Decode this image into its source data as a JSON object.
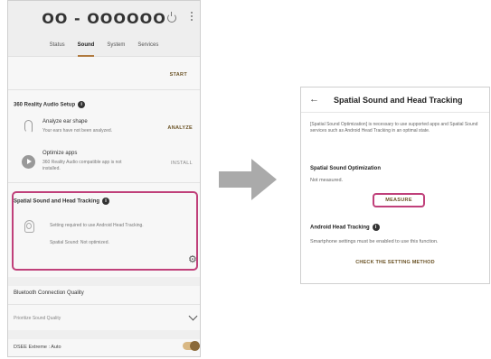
{
  "left_screen": {
    "device_name": "OO - OOOOOO",
    "tabs": [
      {
        "label": "Status"
      },
      {
        "label": "Sound"
      },
      {
        "label": "System"
      },
      {
        "label": "Services"
      }
    ],
    "start_label": "START",
    "reality_audio": {
      "title": "360 Reality Audio Setup",
      "analyze": {
        "title": "Analyze ear shape",
        "subtitle": "Your ears have not been analyzed.",
        "action": "ANALYZE"
      },
      "optimize": {
        "title": "Optimize apps",
        "subtitle": "360 Reality Audio compatible app is not installed.",
        "action": "INSTALL"
      }
    },
    "spatial": {
      "title": "Spatial Sound and Head Tracking",
      "line1": "Setting required to use Android Head Tracking.",
      "line2": "Spatial Sound: Not optimized."
    },
    "bt_quality": {
      "title": "Bluetooth Connection Quality",
      "value": "Prioritize Sound Quality"
    },
    "dsee": {
      "label": "DSEE Extreme : Auto",
      "enabled": true
    },
    "accent_color": "#b07a3f",
    "highlight_color": "#c0407a"
  },
  "right_screen": {
    "title": "Spatial Sound and Head Tracking",
    "description": "[Spatial Sound Optimization] is necessary to use supported apps and Spatial Sound services such as Android Head Tracking in an optimal state.",
    "optimization": {
      "title": "Spatial Sound Optimization",
      "status": "Not measured.",
      "button": "MEASURE"
    },
    "head_tracking": {
      "title": "Android Head Tracking",
      "text": "Smartphone settings must be enabled to use this function.",
      "link": "CHECK THE SETTING METHOD"
    }
  }
}
